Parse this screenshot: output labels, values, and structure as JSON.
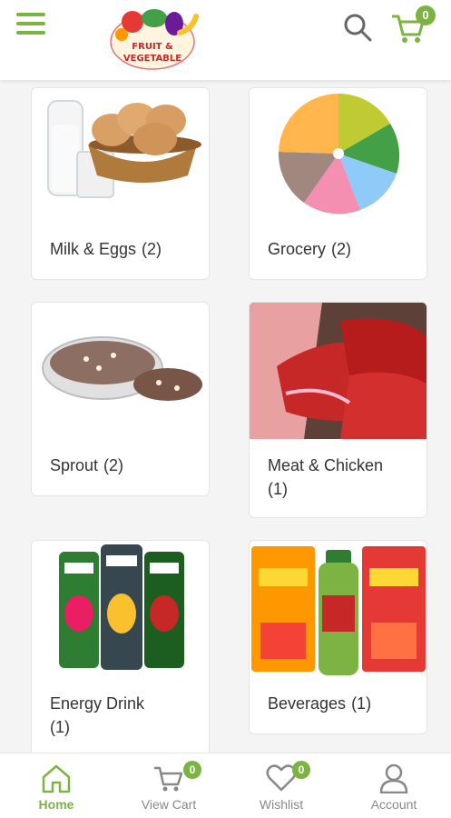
{
  "header": {
    "logo_text_line1": "FRUIT &",
    "logo_text_line2": "VEGETABLE",
    "cart_count": "0",
    "accent_color": "#7cb342"
  },
  "categories": [
    {
      "name": "Milk & Eggs",
      "count": "(2)",
      "icon": "milk-eggs-image"
    },
    {
      "name": "Grocery",
      "count": "(2)",
      "icon": "grocery-image"
    },
    {
      "name": "Sprout",
      "count": "(2)",
      "icon": "sprout-image"
    },
    {
      "name": "Meat & Chicken",
      "count": "(1)",
      "icon": "meat-image"
    },
    {
      "name": "Energy Drink",
      "count": "(1)",
      "icon": "energy-drink-image"
    },
    {
      "name": "Beverages",
      "count": "(1)",
      "icon": "beverages-image"
    }
  ],
  "bottom_nav": {
    "home": "Home",
    "view_cart": "View Cart",
    "view_cart_badge": "0",
    "wishlist": "Wishlist",
    "wishlist_badge": "0",
    "account": "Account"
  }
}
